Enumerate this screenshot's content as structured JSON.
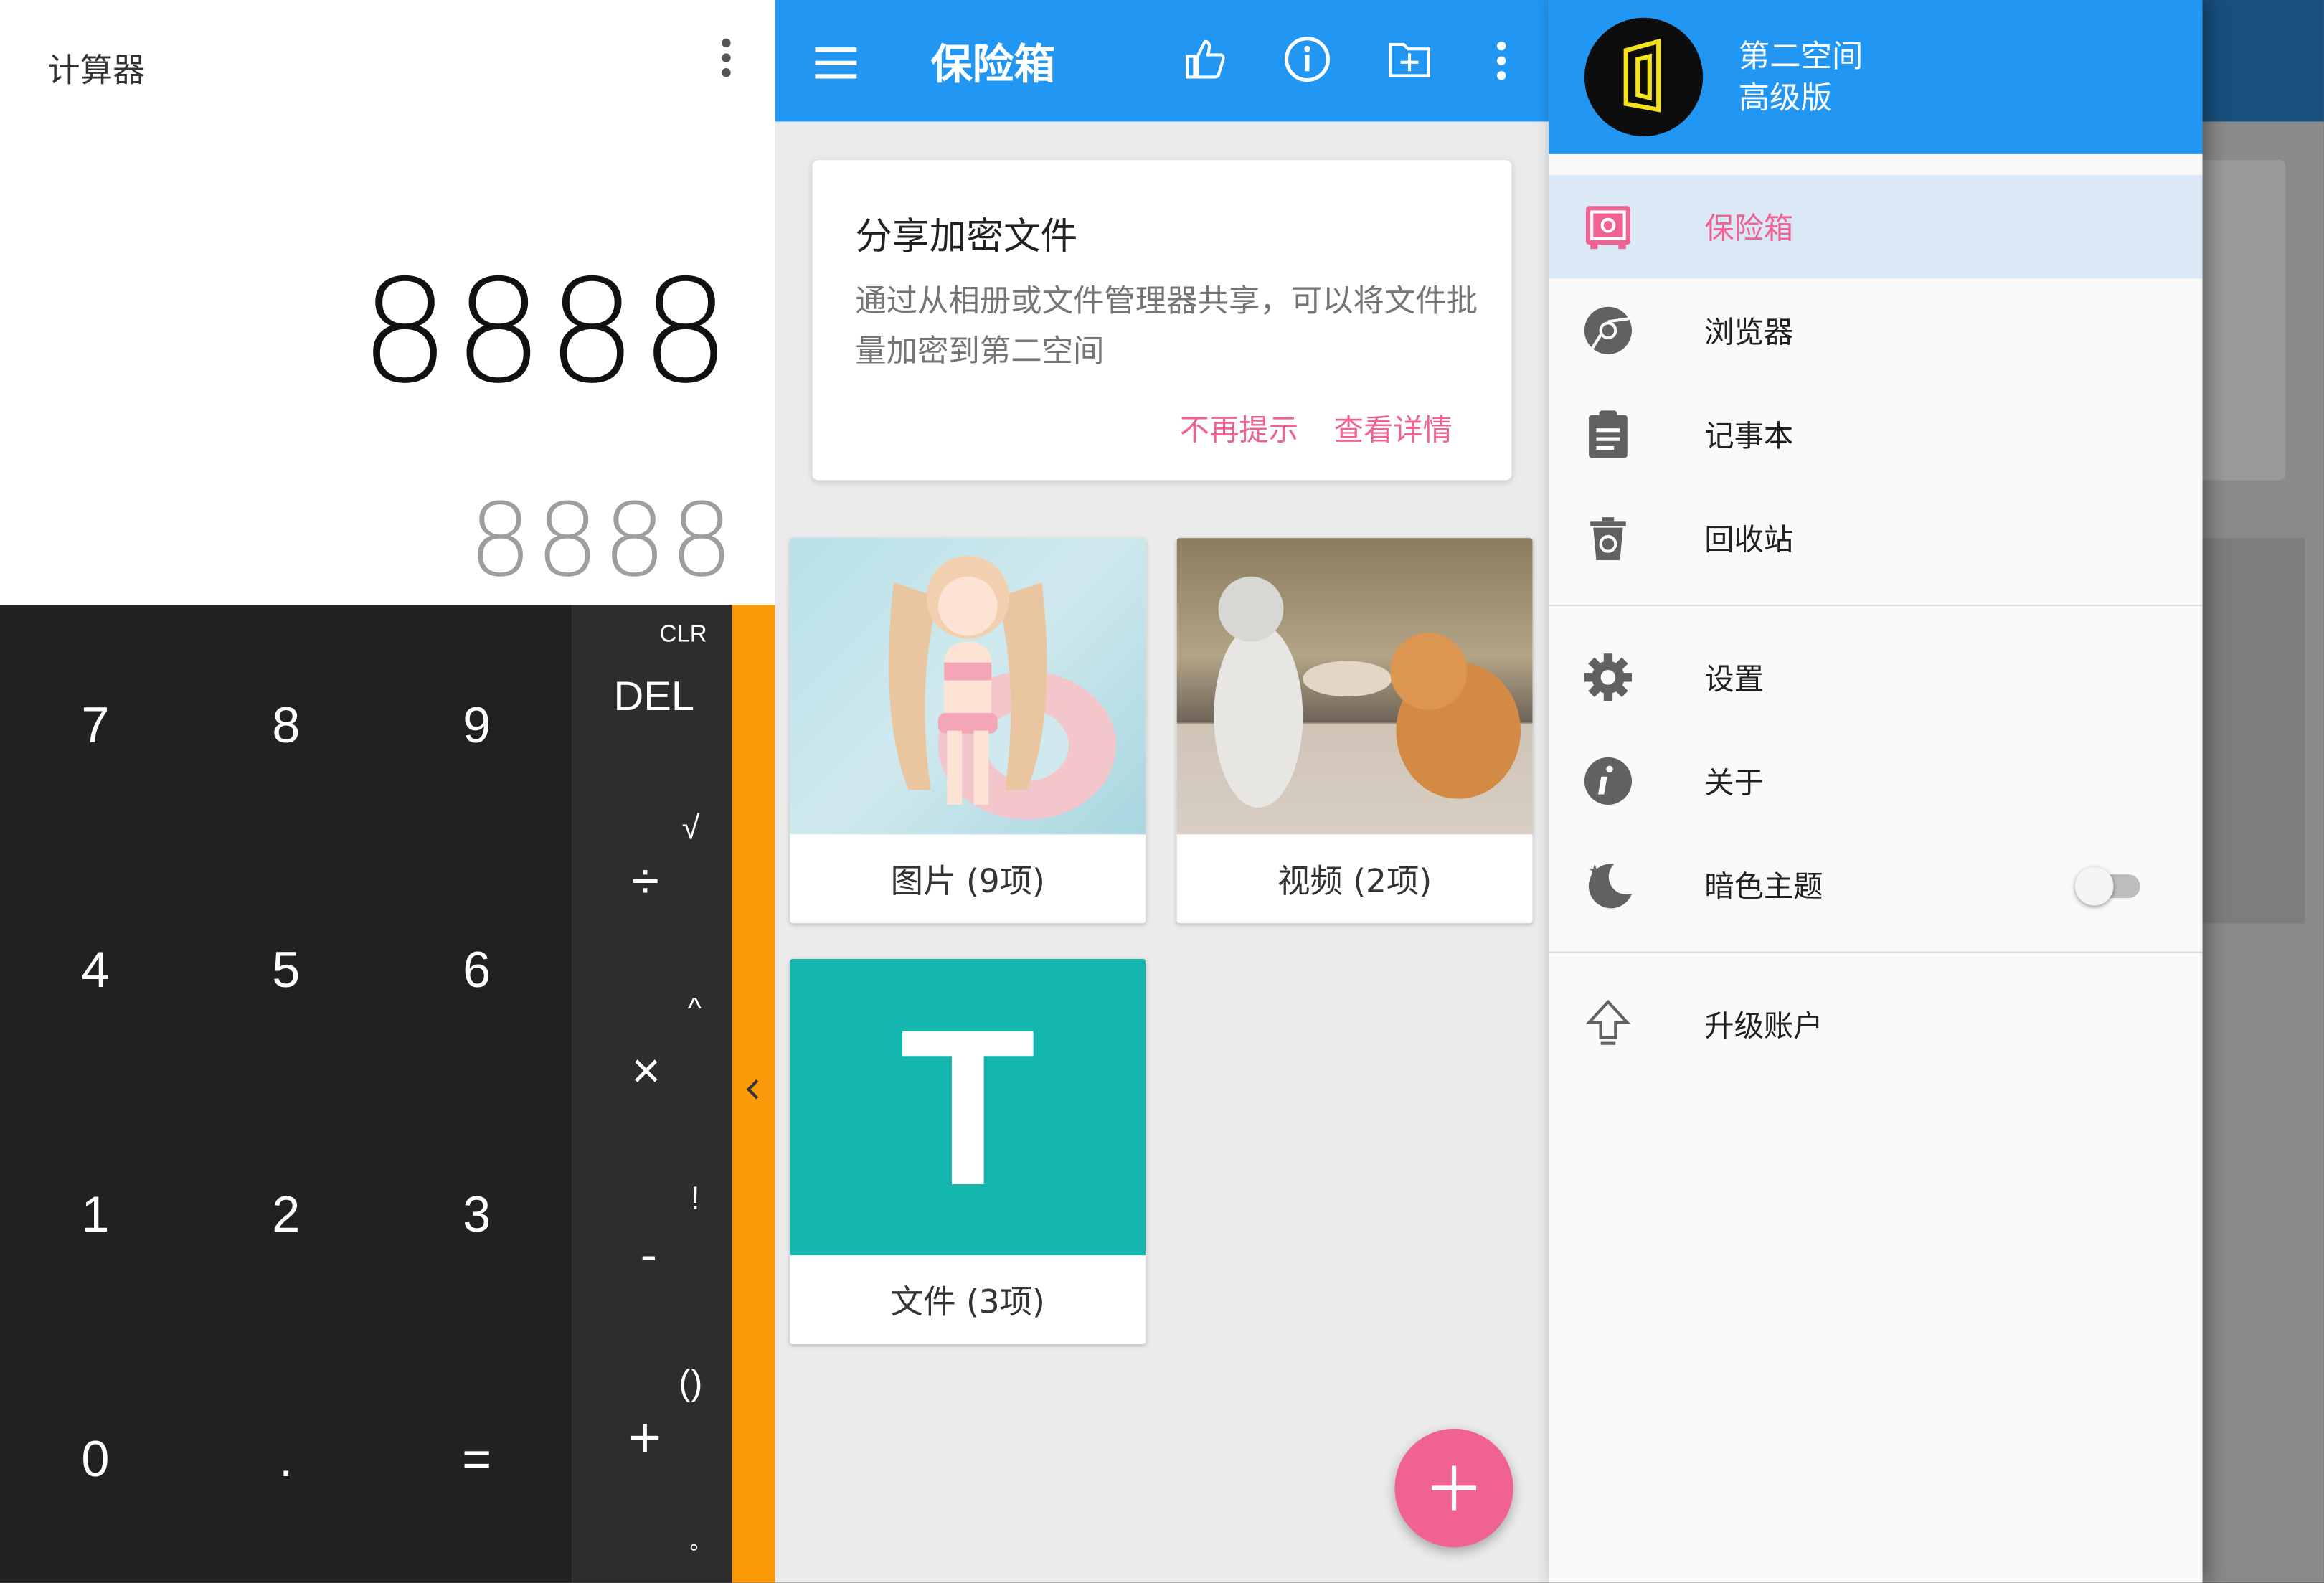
{
  "calculator": {
    "title": "计算器",
    "expression": "8888",
    "result": "8888",
    "digits": [
      "7",
      "8",
      "9",
      "4",
      "5",
      "6",
      "1",
      "2",
      "3",
      "0",
      ".",
      "="
    ],
    "ops": {
      "clr": "CLR",
      "del": "DEL",
      "sqrt": "√",
      "divide": "÷",
      "power": "^",
      "multiply": "×",
      "factorial": "!",
      "minus": "-",
      "parens": "()",
      "plus": "+",
      "degree": "°"
    }
  },
  "vault": {
    "title": "保险箱",
    "tip": {
      "title": "分享加密文件",
      "body": "通过从相册或文件管理器共享，可以将文件批量加密到第二空间",
      "dismiss": "不再提示",
      "details": "查看详情"
    },
    "tiles": [
      {
        "label": "图片 (9项)"
      },
      {
        "label": "视频 (2项)"
      },
      {
        "label": "文件 (3项)",
        "letter": "T"
      }
    ]
  },
  "drawer": {
    "app_name": "第二空间",
    "edition": "高级版",
    "items": [
      {
        "label": "保险箱",
        "icon": "safe-icon",
        "selected": true
      },
      {
        "label": "浏览器",
        "icon": "browser-icon"
      },
      {
        "label": "记事本",
        "icon": "notepad-icon"
      },
      {
        "label": "回收站",
        "icon": "recycle-bin-icon"
      },
      {
        "label": "设置",
        "icon": "gear-icon"
      },
      {
        "label": "关于",
        "icon": "info-icon"
      },
      {
        "label": "暗色主题",
        "icon": "moon-icon",
        "toggle": false
      },
      {
        "label": "升级账户",
        "icon": "upgrade-arrow-icon"
      }
    ]
  },
  "colors": {
    "primary": "#2196f3",
    "accent": "#f06292",
    "orange": "#fb9a09",
    "teal": "#14b6ad"
  }
}
